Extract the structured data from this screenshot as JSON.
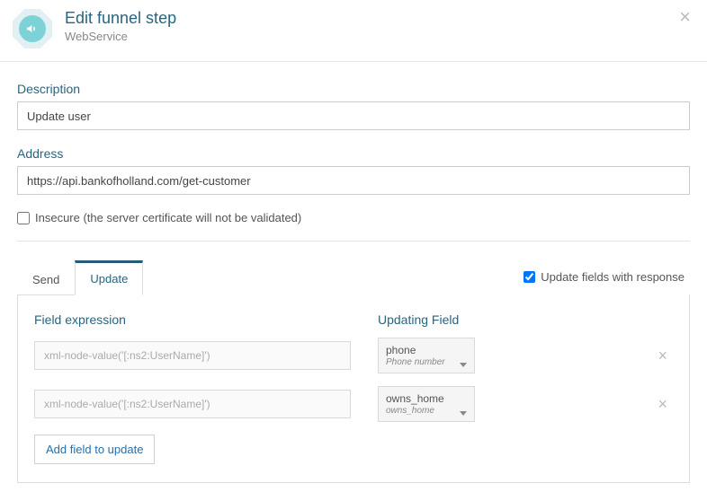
{
  "header": {
    "title": "Edit funnel step",
    "subtitle": "WebService"
  },
  "form": {
    "description_label": "Description",
    "description_value": "Update user",
    "address_label": "Address",
    "address_value": "https://api.bankofholland.com/get-customer",
    "insecure_label": "Insecure (the server certificate will not be validated)"
  },
  "tabs": {
    "send": "Send",
    "update": "Update"
  },
  "update_response_label": "Update fields with response",
  "panel": {
    "col_expr": "Field expression",
    "col_field": "Updating Field",
    "expr_placeholder": "xml-node-value('[:ns2:UserName]')",
    "rows": [
      {
        "field_name": "phone",
        "field_sub": "Phone number"
      },
      {
        "field_name": "owns_home",
        "field_sub": "owns_home"
      }
    ],
    "add_label": "Add field to update"
  }
}
